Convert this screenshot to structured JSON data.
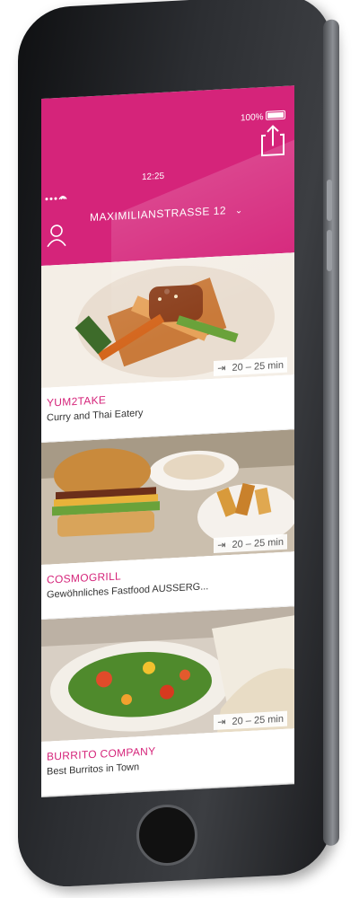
{
  "status_bar": {
    "time": "12:25",
    "battery": "100%"
  },
  "header": {
    "location": "MAXIMILIANSTRASSE 12",
    "accent_color": "#d5247a",
    "icons": [
      "wifi-icon",
      "battery-icon",
      "share-icon",
      "chevron-down-icon",
      "profile-icon"
    ]
  },
  "restaurants": [
    {
      "name": "YUM2TAKE",
      "description": "Curry and Thai Eatery",
      "delivery_time": "20 – 25 min",
      "image": "thai-dish-image"
    },
    {
      "name": "COSMOGRILL",
      "description": "Gewöhnliches Fastfood AUSSERG...",
      "delivery_time": "20 – 25 min",
      "image": "burger-image"
    },
    {
      "name": "BURRITO COMPANY",
      "description": "Best Burritos in Town",
      "delivery_time": "20 – 25 min",
      "image": "burrito-salad-image"
    }
  ]
}
